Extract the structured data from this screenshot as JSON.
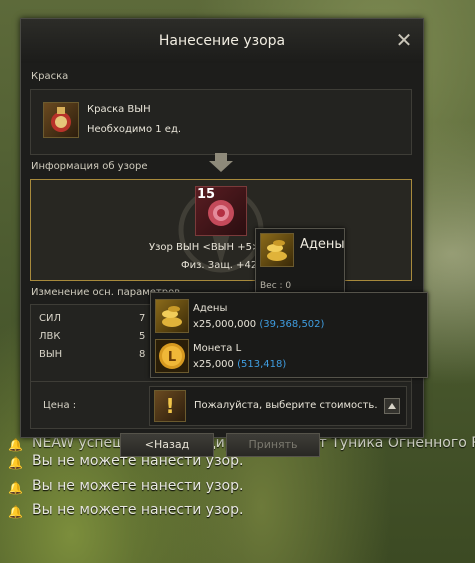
{
  "window": {
    "title": "Нанесение узора"
  },
  "dye": {
    "section_label": "Краска",
    "item_name": "Краска ВЫН",
    "item_requirement": "Необходимо 1 ед."
  },
  "pattern": {
    "section_label": "Информация об узоре",
    "level": "15",
    "name": "Узор ВЫН <ВЫН +5>",
    "effect": "Физ. Защ. +42"
  },
  "stats": {
    "section_label": "Изменение осн. параметров",
    "rows": [
      {
        "label": "СИЛ",
        "value": "7"
      },
      {
        "label": "ЛВК",
        "value": "5"
      },
      {
        "label": "ВЫН",
        "value": "8"
      }
    ]
  },
  "price": {
    "label": "Цена :",
    "prompt": "Пожалуйста, выберите стоимость."
  },
  "buttons": {
    "back": "<Назад",
    "confirm": "Принять"
  },
  "tooltip_small": {
    "title": "Адены",
    "weight": "Вес : 0"
  },
  "price_options": [
    {
      "name": "Адены",
      "amount": "x25,000,000",
      "owned": "(39,368,502)"
    },
    {
      "name": "Монета L",
      "amount": "x25,000",
      "owned": "(513,418)"
    }
  ],
  "chat": {
    "partial_line": "NEAW успешно модифицирует предмет Туника Огненного Рыцаря",
    "lines": [
      "Вы не можете нанести узор.",
      "Вы не можете нанести узор.",
      "Вы не можете нанести узор."
    ]
  },
  "colors": {
    "gold_border": "#a88a3c",
    "owned_blue": "#3f9de0"
  }
}
